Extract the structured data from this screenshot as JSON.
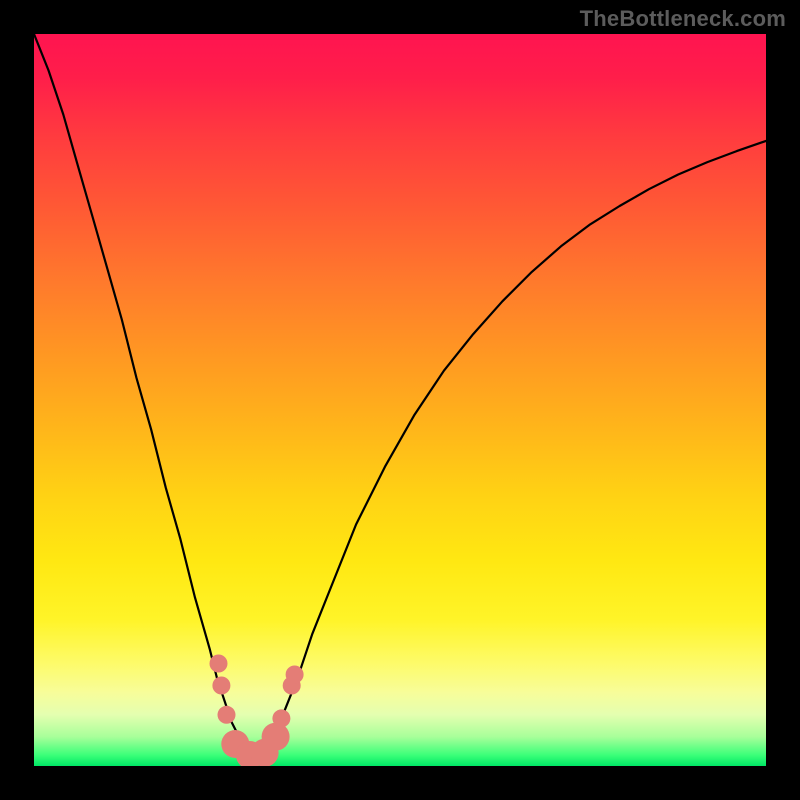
{
  "watermark": "TheBottleneck.com",
  "chart_data": {
    "type": "line",
    "title": "",
    "xlabel": "",
    "ylabel": "",
    "xlim": [
      0,
      100
    ],
    "ylim": [
      0,
      100
    ],
    "series": [
      {
        "name": "bottleneck-curve",
        "x": [
          0,
          2,
          4,
          6,
          8,
          10,
          12,
          14,
          16,
          18,
          20,
          22,
          24,
          25,
          26,
          27,
          28,
          29,
          30,
          31,
          32,
          33,
          34,
          36,
          38,
          40,
          44,
          48,
          52,
          56,
          60,
          64,
          68,
          72,
          76,
          80,
          84,
          88,
          92,
          96,
          100
        ],
        "y": [
          100,
          95,
          89,
          82,
          75,
          68,
          61,
          53,
          46,
          38,
          31,
          23,
          16,
          12,
          9,
          6,
          4,
          2.5,
          1.5,
          1.5,
          2.5,
          4,
          7,
          12,
          18,
          23,
          33,
          41,
          48,
          54,
          59,
          63.5,
          67.5,
          71,
          74,
          76.5,
          78.8,
          80.8,
          82.5,
          84,
          85.4
        ]
      }
    ],
    "markers": [
      {
        "x": 25.2,
        "y": 14.0,
        "size": "small"
      },
      {
        "x": 25.6,
        "y": 11.0,
        "size": "small"
      },
      {
        "x": 26.3,
        "y": 7.0,
        "size": "small"
      },
      {
        "x": 27.5,
        "y": 3.0,
        "size": "big"
      },
      {
        "x": 29.5,
        "y": 1.5,
        "size": "big"
      },
      {
        "x": 31.5,
        "y": 1.8,
        "size": "big"
      },
      {
        "x": 33.0,
        "y": 4.0,
        "size": "big"
      },
      {
        "x": 33.8,
        "y": 6.5,
        "size": "small"
      },
      {
        "x": 35.2,
        "y": 11.0,
        "size": "small"
      },
      {
        "x": 35.6,
        "y": 12.5,
        "size": "small"
      }
    ],
    "colors": {
      "curve": "#000000",
      "marker": "#e47d76",
      "gradient_top": "#ff1450",
      "gradient_bottom": "#00e765"
    }
  }
}
